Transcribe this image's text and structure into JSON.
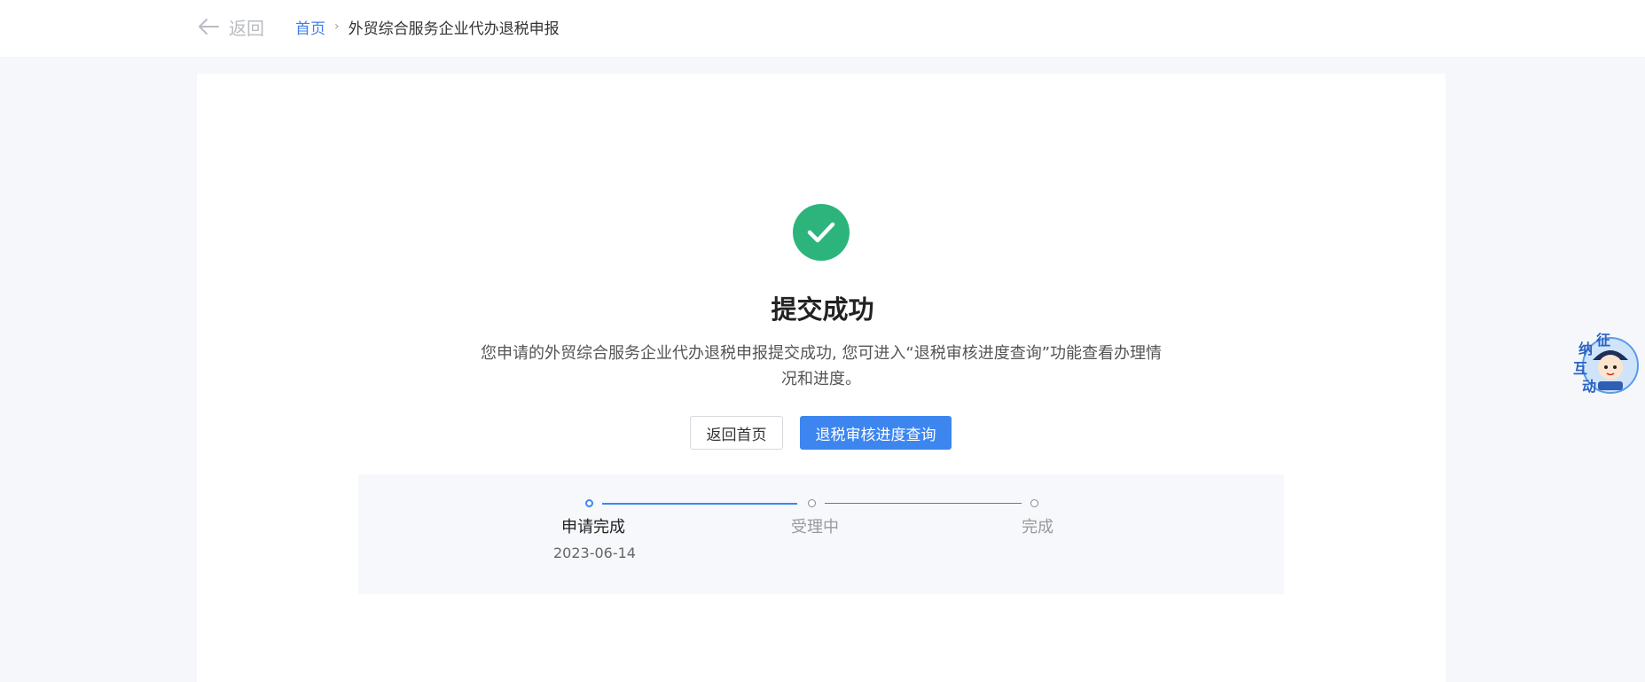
{
  "header": {
    "back_label": "返回",
    "breadcrumb": {
      "home": "首页",
      "separator": "›",
      "current": "外贸综合服务企业代办退税申报"
    }
  },
  "result": {
    "status_icon": "check-circle-icon",
    "title": "提交成功",
    "description": "您申请的外贸综合服务企业代办退税申报提交成功, 您可进入“退税审核进度查询”功能查看办理情况和进度。"
  },
  "actions": {
    "home_button": "返回首页",
    "query_button": "退税审核进度查询"
  },
  "progress": {
    "steps": [
      {
        "label": "申请完成",
        "date": "2023-06-14",
        "state": "done"
      },
      {
        "label": "受理中",
        "date": "",
        "state": "pending"
      },
      {
        "label": "完成",
        "date": "",
        "state": "pending"
      }
    ]
  },
  "widget": {
    "mascot_text": [
      "征",
      "纳",
      "互",
      "动"
    ]
  },
  "colors": {
    "accent": "#3d86f0",
    "success": "#2db47d",
    "link": "#3d7fe8"
  }
}
